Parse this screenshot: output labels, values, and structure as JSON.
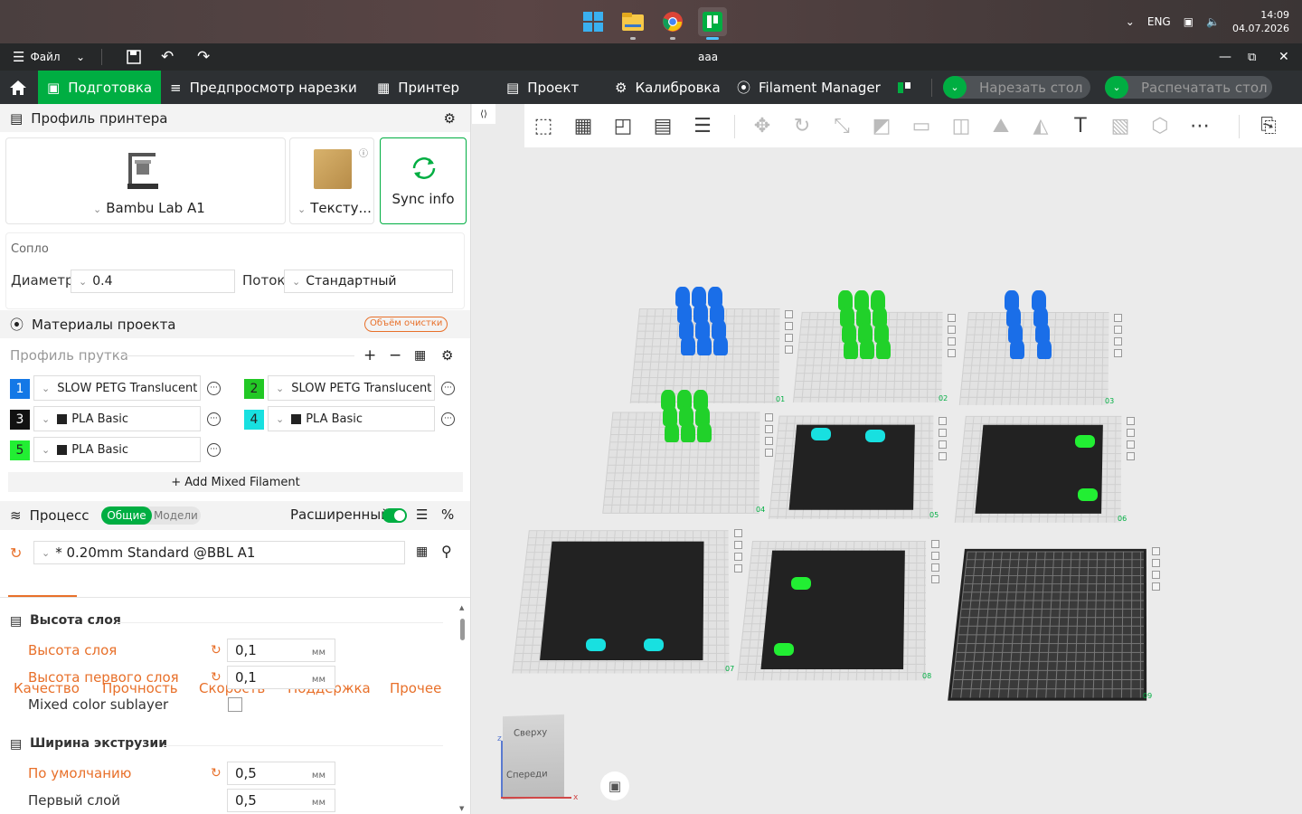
{
  "taskbar": {
    "apps": [
      "windows-start-icon",
      "file-explorer-icon",
      "chrome-icon",
      "bambu-studio-icon"
    ],
    "lang": "ENG",
    "time": "14:09",
    "date": "04.07.2026"
  },
  "titlebar": {
    "file_menu": "Файл",
    "title": "aaa"
  },
  "nav": {
    "prepare": "Подготовка",
    "preview": "Предпросмотр нарезки",
    "printer": "Принтер",
    "project": "Проект",
    "calibration": "Калибровка",
    "filament_manager": "Filament Manager",
    "slice_plate": "Нарезать стол",
    "print_plate": "Распечатать стол"
  },
  "printer_profile": {
    "header": "Профиль принтера",
    "printer_name": "Bambu Lab A1",
    "plate_type": "Тексту...",
    "sync": "Sync info",
    "nozzle_section": "Сопло",
    "diameter_label": "Диаметр",
    "diameter_value": "0.4",
    "flow_label": "Поток",
    "flow_value": "Стандартный"
  },
  "materials": {
    "header": "Материалы проекта",
    "purge_badge": "Объём очистки",
    "filament_profile": "Профиль прутка",
    "filaments": [
      {
        "num": "1",
        "name": "SLOW PETG Translucent",
        "color": "#1478e6",
        "text_color": "#ffffff"
      },
      {
        "num": "2",
        "name": "SLOW PETG Translucent",
        "color": "#22c825",
        "text_color": "#222222"
      },
      {
        "num": "3",
        "name": "PLA Basic",
        "color": "#111111",
        "text_color": "#ffffff"
      },
      {
        "num": "4",
        "name": "PLA Basic",
        "color": "#18e0e0",
        "text_color": "#222222"
      },
      {
        "num": "5",
        "name": "PLA Basic",
        "color": "#22ee33",
        "text_color": "#222222"
      }
    ],
    "add_mixed": "+ Add Mixed Filament"
  },
  "process": {
    "header": "Процесс",
    "toggle_general": "Общие",
    "toggle_models": "Модели",
    "advanced": "Расширенный",
    "preset": "* 0.20mm Standard @BBL A1",
    "tabs": [
      "Качество",
      "Прочность",
      "Скорость",
      "Поддержка",
      "Прочее"
    ],
    "group_layer_height": "Высота слоя",
    "layer_height_label": "Высота слоя",
    "layer_height_value": "0,1",
    "first_layer_height_label": "Высота первого слоя",
    "first_layer_height_value": "0,1",
    "mixed_sublayer_label": "Mixed color sublayer",
    "group_line_width": "Ширина экструзии",
    "default_width_label": "По умолчанию",
    "default_width_value": "0,5",
    "first_layer_width_label": "Первый слой",
    "first_layer_width_value": "0,5",
    "unit": "мм"
  },
  "viewport": {
    "view_top": "Сверху",
    "view_front": "Спереди",
    "axis_z": "z",
    "axis_x": "x",
    "plates": [
      "01",
      "02",
      "03",
      "04",
      "05",
      "06",
      "07",
      "08",
      "09"
    ]
  }
}
